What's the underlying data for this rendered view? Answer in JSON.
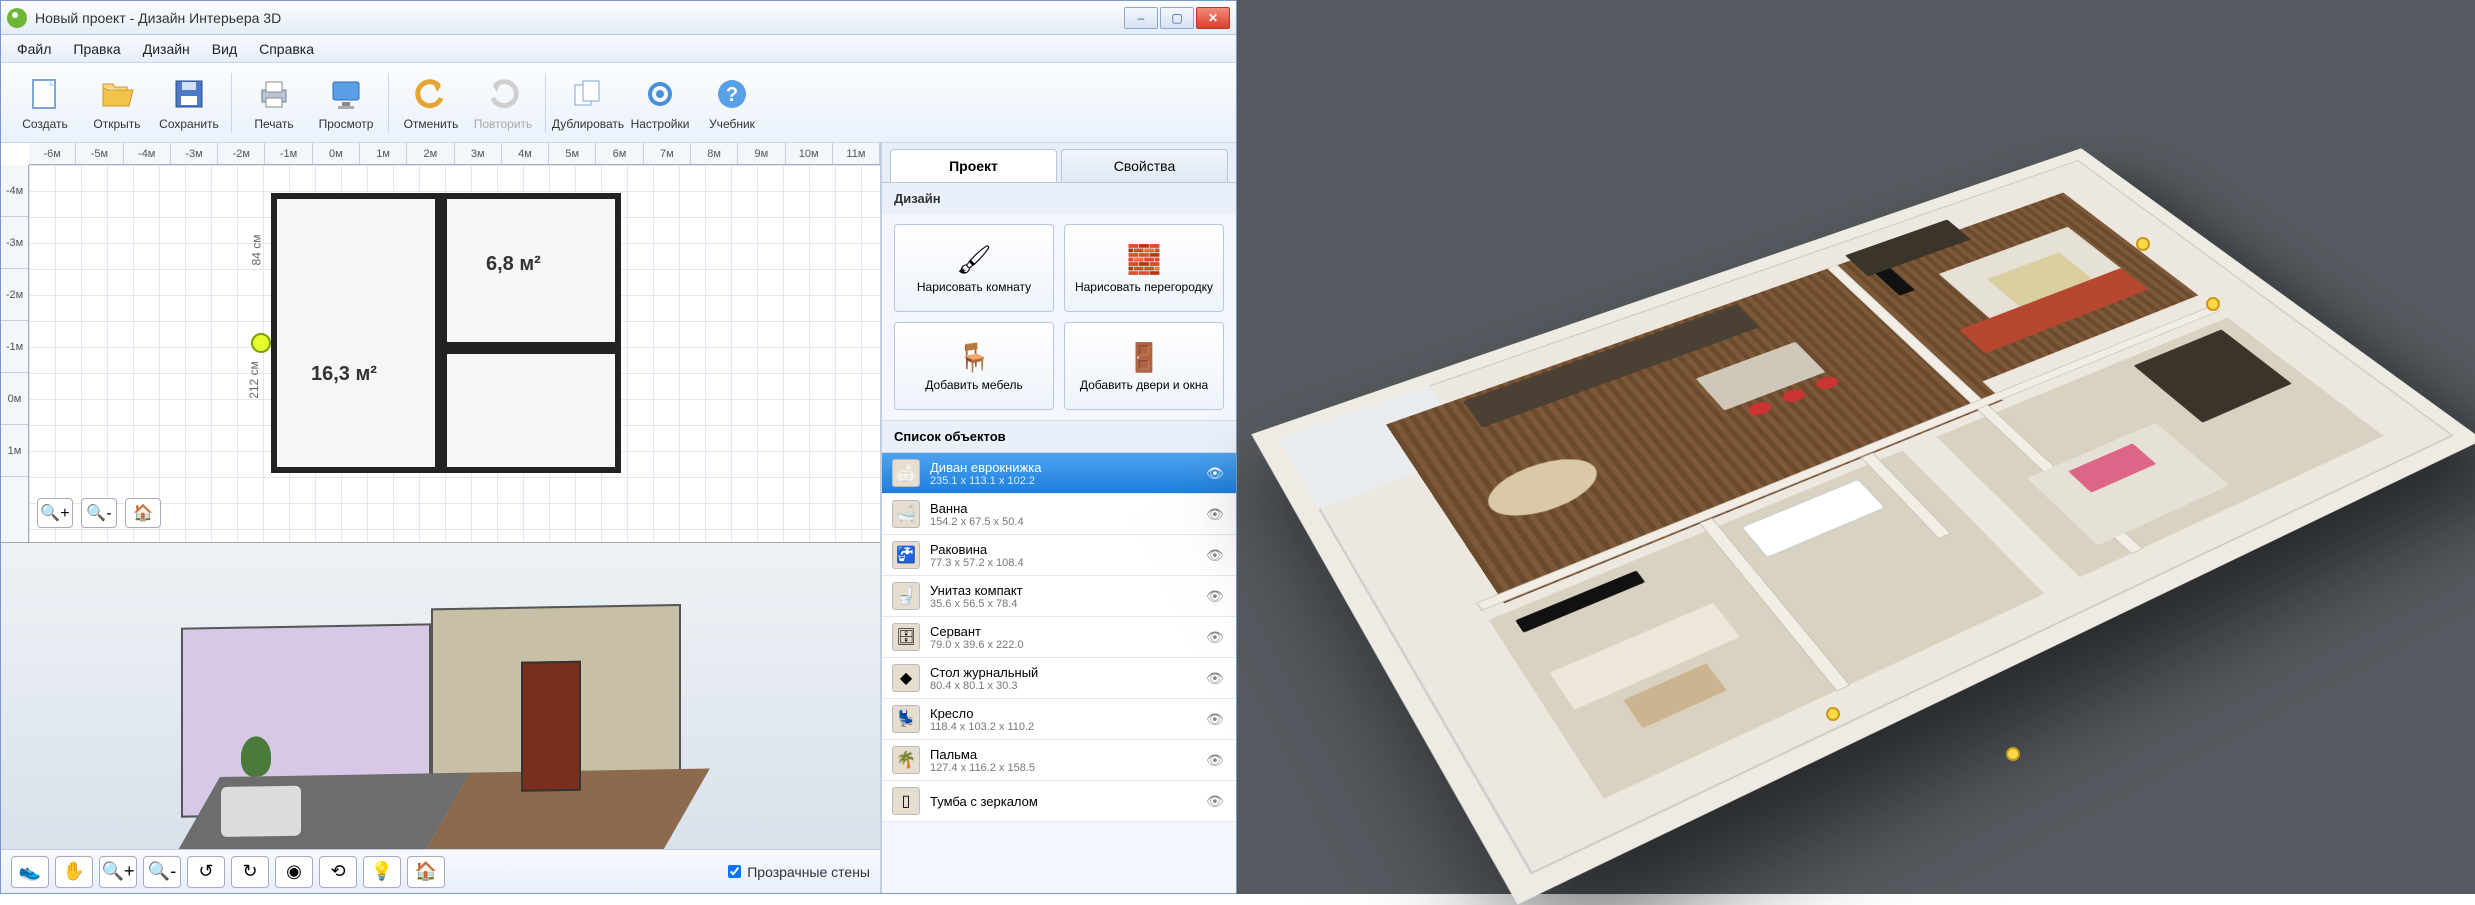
{
  "window": {
    "title": "Новый проект - Дизайн Интерьера 3D"
  },
  "menu": {
    "file": "Файл",
    "edit": "Правка",
    "design": "Дизайн",
    "view": "Вид",
    "help": "Справка"
  },
  "toolbar": {
    "create": "Создать",
    "open": "Открыть",
    "save": "Сохранить",
    "print": "Печать",
    "preview": "Просмотр",
    "undo": "Отменить",
    "redo": "Повторить",
    "duplicate": "Дублировать",
    "settings": "Настройки",
    "tutorial": "Учебник"
  },
  "ruler_h": [
    "-6м",
    "-5м",
    "-4м",
    "-3м",
    "-2м",
    "-1м",
    "0м",
    "1м",
    "2м",
    "3м",
    "4м",
    "5м",
    "6м",
    "7м",
    "8м",
    "9м",
    "10м",
    "11м"
  ],
  "ruler_v": [
    "-4м",
    "-3м",
    "-2м",
    "-1м",
    "0м",
    "1м"
  ],
  "rooms": {
    "r1_area": "16,3 м²",
    "r2_area": "6,8 м²",
    "dim1": "84 см",
    "dim2": "212 см"
  },
  "tabs": {
    "project": "Проект",
    "props": "Свойства"
  },
  "section": {
    "design": "Дизайн",
    "objects": "Список объектов"
  },
  "design_buttons": {
    "draw_room": "Нарисовать комнату",
    "draw_wall": "Нарисовать перегородку",
    "add_furn": "Добавить мебель",
    "add_doors": "Добавить двери и окна"
  },
  "objects": [
    {
      "name": "Диван еврокнижка",
      "dims": "235.1 x 113.1 x 102.2",
      "icon": "🛋"
    },
    {
      "name": "Ванна",
      "dims": "154.2 x 67.5 x 50.4",
      "icon": "🛁"
    },
    {
      "name": "Раковина",
      "dims": "77.3 x 57.2 x 108.4",
      "icon": "🚰"
    },
    {
      "name": "Унитаз компакт",
      "dims": "35.6 x 56.5 x 78.4",
      "icon": "🚽"
    },
    {
      "name": "Сервант",
      "dims": "79.0 x 39.6 x 222.0",
      "icon": "🗄"
    },
    {
      "name": "Стол журнальный",
      "dims": "80.4 x 80.1 x 30.3",
      "icon": "◆"
    },
    {
      "name": "Кресло",
      "dims": "118.4 x 103.2 x 110.2",
      "icon": "💺"
    },
    {
      "name": "Пальма",
      "dims": "127.4 x 116.2 x 158.5",
      "icon": "🌴"
    },
    {
      "name": "Тумба с зеркалом",
      "dims": "",
      "icon": "▯"
    }
  ],
  "bottom": {
    "transparent": "Прозрачные стены"
  }
}
